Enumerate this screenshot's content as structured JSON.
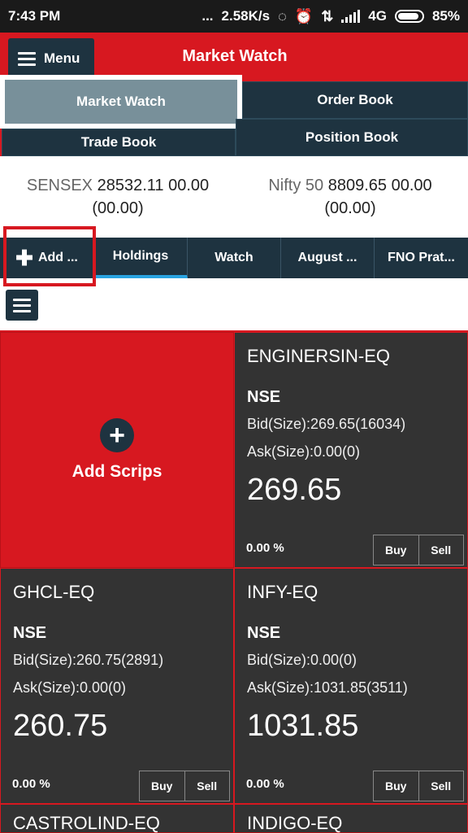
{
  "statusbar": {
    "time": "7:43 PM",
    "dots": "...",
    "speed": "2.58K/s",
    "network": "4G",
    "battery": "85%",
    "icons": [
      "sync-icon",
      "alarm-icon",
      "data-arrows-icon",
      "signal-icon",
      "battery-icon"
    ]
  },
  "appbar": {
    "menu_label": "Menu",
    "title": "Market Watch"
  },
  "topgrid": {
    "items": [
      {
        "label": "Market Watch",
        "active": true
      },
      {
        "label": "Order Book",
        "active": false
      },
      {
        "label": "Trade Book",
        "active": false
      },
      {
        "label": "Position Book",
        "active": false
      }
    ]
  },
  "indices": [
    {
      "name": "SENSEX",
      "value": "28532.11",
      "change": "00.00",
      "pct": "(00.00)"
    },
    {
      "name": "Nifty 50",
      "value": "8809.65",
      "change": "00.00",
      "pct": "(00.00)"
    }
  ],
  "watchlist_tabs": [
    {
      "label": "Add ...",
      "icon": "plus-icon"
    },
    {
      "label": "Holdings",
      "active": true
    },
    {
      "label": "Watch"
    },
    {
      "label": "August ..."
    },
    {
      "label": "FNO Prat..."
    }
  ],
  "add_tile": {
    "label": "Add Scrips",
    "icon": "plus-circle-icon"
  },
  "scrips": [
    {
      "name": "ENGINERSIN-EQ",
      "exchange": "NSE",
      "bid": "Bid(Size):269.65(16034)",
      "ask": "Ask(Size):0.00(0)",
      "ltp": "269.65",
      "change": "0.00 %",
      "buy": "Buy",
      "sell": "Sell"
    },
    {
      "name": "GHCL-EQ",
      "exchange": "NSE",
      "bid": "Bid(Size):260.75(2891)",
      "ask": "Ask(Size):0.00(0)",
      "ltp": "260.75",
      "change": "0.00 %",
      "buy": "Buy",
      "sell": "Sell"
    },
    {
      "name": "INFY-EQ",
      "exchange": "NSE",
      "bid": "Bid(Size):0.00(0)",
      "ask": "Ask(Size):1031.85(3511)",
      "ltp": "1031.85",
      "change": "0.00 %",
      "buy": "Buy",
      "sell": "Sell"
    },
    {
      "name": "CASTROLIND-EQ"
    },
    {
      "name": "INDIGO-EQ"
    }
  ],
  "colors": {
    "brand_red": "#d71820",
    "navy": "#1e3340",
    "tile_dark": "#333333",
    "active_tab_gray": "#78909a",
    "underline_blue": "#29a3e0"
  }
}
